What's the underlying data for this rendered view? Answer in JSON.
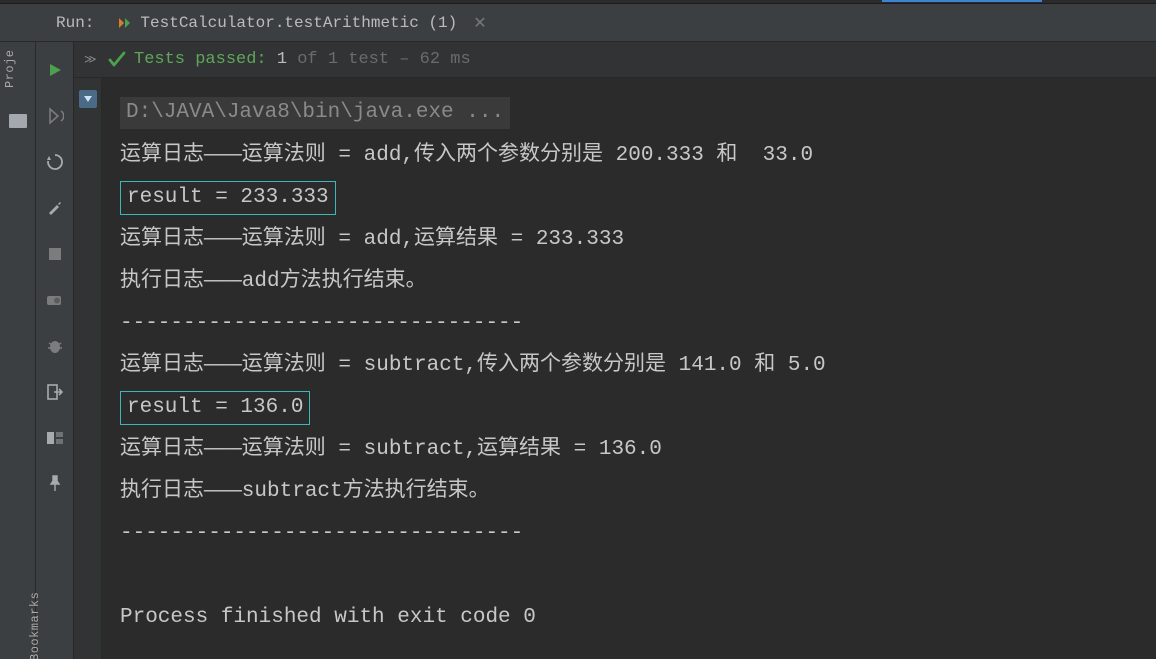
{
  "left_sidebar": {
    "projects_label": "Proje",
    "bookmarks_label": "Bookmarks"
  },
  "tabbar": {
    "run_label": "Run:",
    "tab_title": "TestCalculator.testArithmetic (1)"
  },
  "status": {
    "prefix": "Tests passed: ",
    "passed_count": "1",
    "mid": " of 1 test – ",
    "time": "62 ms"
  },
  "console": {
    "cmd": "D:\\JAVA\\Java8\\bin\\java.exe ...",
    "line1": "运算日志———运算法则 = add,传入两个参数分别是 200.333 和  33.0",
    "result1": "result = 233.333",
    "line2": "运算日志———运算法则 = add,运算结果 = 233.333",
    "line3": "执行日志———add方法执行结束。",
    "sep1": "--------------------------------",
    "line4": "运算日志———运算法则 = subtract,传入两个参数分别是 141.0 和 5.0",
    "result2": "result = 136.0",
    "line5": "运算日志———运算法则 = subtract,运算结果 = 136.0",
    "line6": "执行日志———subtract方法执行结束。",
    "sep2": "--------------------------------",
    "exit": "Process finished with exit code 0"
  }
}
